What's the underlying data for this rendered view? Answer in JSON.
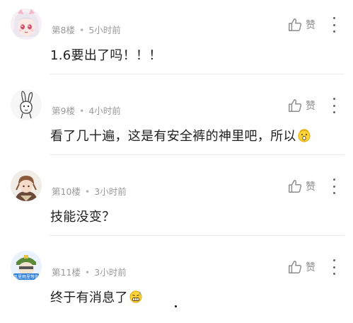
{
  "like_label": "赞",
  "comments": [
    {
      "floor": "第8楼",
      "time": "5小时前",
      "text": "1.6要出了吗！！！"
    },
    {
      "floor": "第9楼",
      "time": "4小时前",
      "text": "看了几十遍，这是有安全裤的神里吧，所以"
    },
    {
      "floor": "第10楼",
      "time": "3小时前",
      "text": "技能没变？"
    },
    {
      "floor": "第11楼",
      "time": "3小时前",
      "text": "终于有消息了",
      "avatar_badge": "风里雨里等你"
    }
  ],
  "colors": {
    "meta_text": "#9a9a9a",
    "body_text": "#1f1f1f",
    "icon": "#8c8c8c",
    "divider": "#ececec"
  },
  "icons": [
    "thumbs-up-icon",
    "more-vertical-icon",
    "surprised-emoji-icon",
    "grimace-emoji-icon"
  ]
}
